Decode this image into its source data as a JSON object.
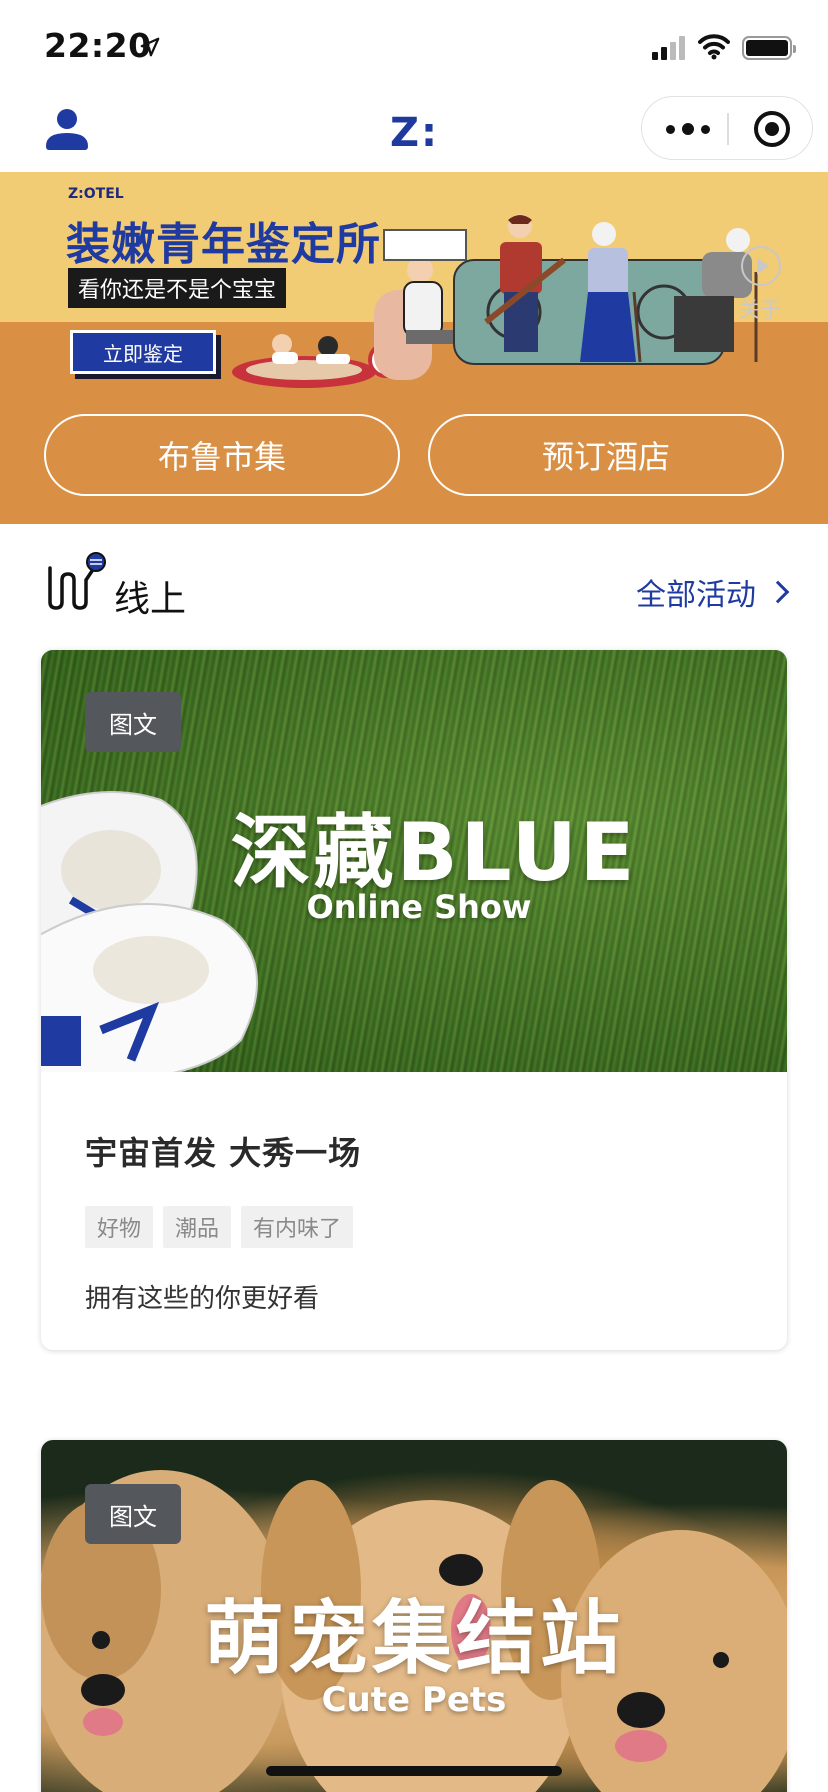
{
  "status_bar": {
    "time": "22:20"
  },
  "nav": {
    "logo": "Z:"
  },
  "banner": {
    "brand": "Z:OTEL",
    "title": "装嫩青年鉴定所",
    "subtitle": "看你还是不是个宝宝",
    "cta": "立即鉴定",
    "about_label": "关于",
    "buttons": [
      {
        "label": "布鲁市集"
      },
      {
        "label": "预订酒店"
      }
    ]
  },
  "section": {
    "title": "线上",
    "view_all": "全部活动"
  },
  "cards": [
    {
      "tag": "图文",
      "image_title": "深藏BLUE",
      "image_subtitle": "Online Show",
      "title": "宇宙首发 大秀一场",
      "chips": [
        "好物",
        "潮品",
        "有内味了"
      ],
      "description": "拥有这些的你更好看"
    },
    {
      "tag": "图文",
      "image_title": "萌宠集结站",
      "image_subtitle": "Cute Pets"
    }
  ],
  "colors": {
    "brand_blue": "#1f3aa0",
    "banner_yellow": "#f2cc75",
    "banner_orange": "#d98f44"
  }
}
